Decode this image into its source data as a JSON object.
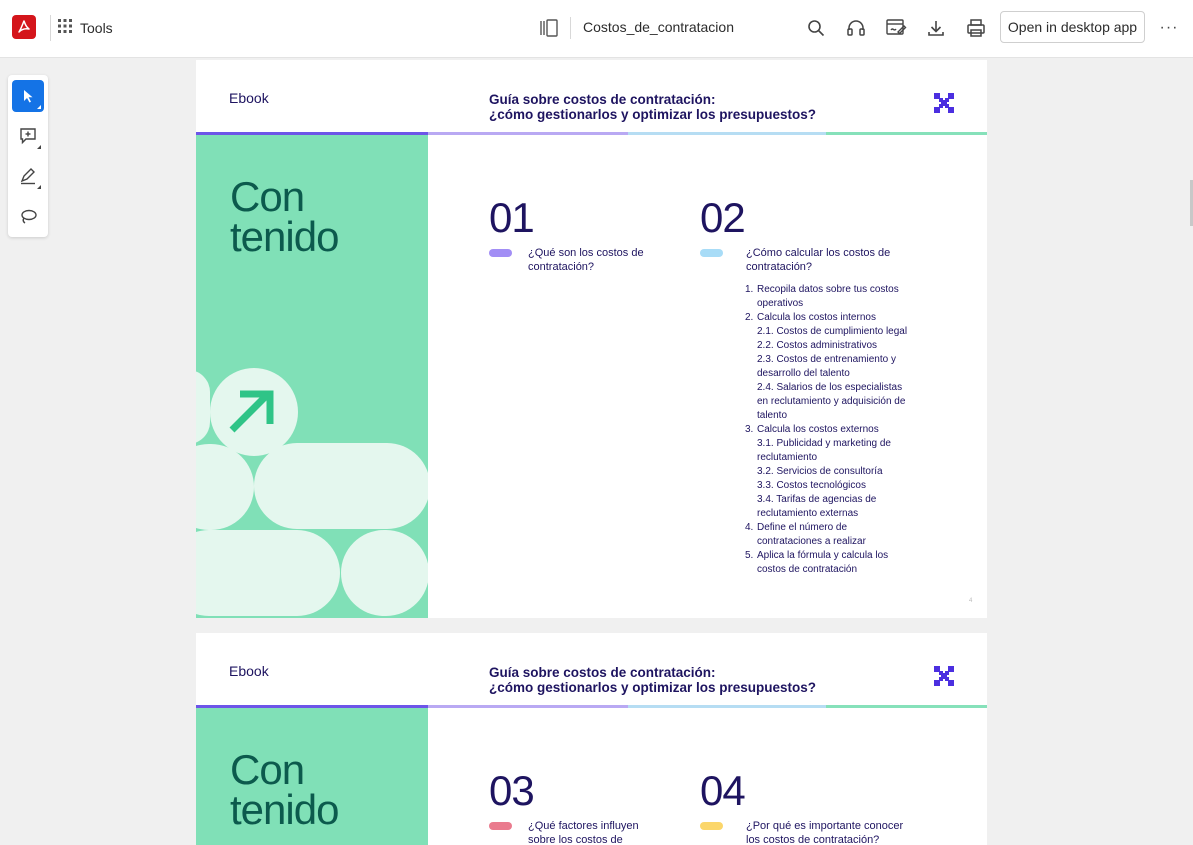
{
  "header": {
    "tools_label": "Tools",
    "document_title": "Costos_de_contratacion",
    "open_desktop_label": "Open in desktop app",
    "more_label": "···"
  },
  "icons": {
    "app_logo": "adobe-acrobat-icon",
    "apps_grid": "apps-grid-icon",
    "thumbnails": "page-thumbnails-icon",
    "search": "search-icon",
    "read_aloud": "headphones-icon",
    "sign": "sign-icon",
    "download": "download-icon",
    "print": "print-icon"
  },
  "rail": {
    "tools": [
      "select-tool",
      "add-comment-tool",
      "highlight-draw-tool",
      "lasso-tool"
    ]
  },
  "pages": [
    {
      "ebook_label": "Ebook",
      "title_line1": "Guía sobre costos de contratación:",
      "title_line2": "¿cómo gestionarlos y optimizar los presupuestos?",
      "con_line1": "Con",
      "con_line2": "tenido",
      "sections": [
        {
          "number": "01",
          "color": "#a28ef5",
          "title_line1": "¿Qué son los costos de",
          "title_line2": "contratación?"
        },
        {
          "number": "02",
          "color": "#a8dcf7",
          "title_line1": "¿Cómo calcular los costos de",
          "title_line2": "contratación?"
        }
      ],
      "toc": [
        {
          "n": "1.",
          "t": "Recopila datos sobre tus costos"
        },
        {
          "n": "",
          "t": "operativos"
        },
        {
          "n": "2.",
          "t": "Calcula los costos internos"
        },
        {
          "n": "",
          "t": "2.1. Costos de cumplimiento legal"
        },
        {
          "n": "",
          "t": "2.2. Costos administrativos"
        },
        {
          "n": "",
          "t": "2.3. Costos de entrenamiento y"
        },
        {
          "n": "",
          "t": "desarrollo del talento"
        },
        {
          "n": "",
          "t": "2.4. Salarios de los especialistas"
        },
        {
          "n": "",
          "t": "en reclutamiento y adquisición de"
        },
        {
          "n": "",
          "t": "talento"
        },
        {
          "n": "3.",
          "t": "Calcula los costos externos"
        },
        {
          "n": "",
          "t": "3.1. Publicidad y marketing de"
        },
        {
          "n": "",
          "t": "reclutamiento"
        },
        {
          "n": "",
          "t": "3.2. Servicios de consultoría"
        },
        {
          "n": "",
          "t": "3.3. Costos tecnológicos"
        },
        {
          "n": "",
          "t": "3.4. Tarifas de agencias de"
        },
        {
          "n": "",
          "t": "reclutamiento externas"
        },
        {
          "n": "4.",
          "t": "Define el número de"
        },
        {
          "n": "",
          "t": "contrataciones a realizar"
        },
        {
          "n": "5.",
          "t": "Aplica la fórmula y calcula los"
        },
        {
          "n": "",
          "t": "costos de contratación"
        }
      ],
      "page_number": "4"
    },
    {
      "ebook_label": "Ebook",
      "title_line1": "Guía sobre costos de contratación:",
      "title_line2": "¿cómo gestionarlos y optimizar los presupuestos?",
      "con_line1": "Con",
      "con_line2": "tenido",
      "sections": [
        {
          "number": "03",
          "color": "#ea7b8e",
          "title_line1": "¿Qué factores influyen",
          "title_line2": "sobre los costos de"
        },
        {
          "number": "04",
          "color": "#fbd66a",
          "title_line1": "¿Por qué es importante conocer",
          "title_line2": "los costos de contratación?"
        }
      ]
    }
  ],
  "colors": {
    "accent_blue": "#1473e6",
    "acrobat_red": "#d4151b",
    "navy": "#1e1460",
    "panel_green": "#80e0b7",
    "panel_text_green": "#0c5a4d",
    "shape_mint": "#e4f7ee",
    "arrow_green": "#2fc487",
    "logo_purple": "#4b2fe0"
  }
}
